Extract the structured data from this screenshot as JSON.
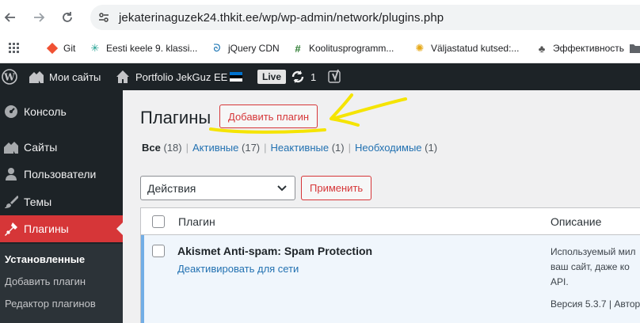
{
  "browser": {
    "url": "jekaterinaguzek24.thkit.ee/wp/wp-admin/network/plugins.php",
    "bookmarks": [
      {
        "label": "Git",
        "icon": "git-icon"
      },
      {
        "label": "Eesti keele 9. klassi...",
        "icon": "puzzle-icon"
      },
      {
        "label": "jQuery CDN",
        "icon": "jquery-icon"
      },
      {
        "label": "Koolitusprogramm...",
        "icon": "hash-icon"
      },
      {
        "label": "Väljastatud kutsed:...",
        "icon": "gear-icon"
      },
      {
        "label": "Эффективность",
        "icon": "drop-icon"
      }
    ]
  },
  "adminbar": {
    "my_sites": "Мои сайты",
    "site_name": "Portfolio JekGuz EE",
    "live_badge": "Live",
    "updates_count": "1"
  },
  "sidebar": {
    "items": [
      {
        "label": "Консоль"
      },
      {
        "label": "Сайты"
      },
      {
        "label": "Пользователи"
      },
      {
        "label": "Темы"
      },
      {
        "label": "Плагины"
      }
    ],
    "submenu": [
      {
        "label": "Установленные"
      },
      {
        "label": "Добавить плагин"
      },
      {
        "label": "Редактор плагинов"
      }
    ]
  },
  "main": {
    "title": "Плагины",
    "add_button": "Добавить плагин",
    "filters": {
      "all": "Все",
      "all_count": "(18)",
      "active": "Активные",
      "active_count": "(17)",
      "inactive": "Неактивные",
      "inactive_count": "(1)",
      "required": "Необходимые",
      "required_count": "(1)"
    },
    "bulk_action": "Действия",
    "apply_button": "Применить",
    "table": {
      "col_plugin": "Плагин",
      "col_description": "Описание",
      "rows": [
        {
          "name": "Akismet Anti-spam: Spam Protection",
          "action": "Деактивировать для сети",
          "desc_line1": "Используемый мил",
          "desc_line2": "ваш сайт, даже ко",
          "desc_line3": "API.",
          "version": "Версия 5.3.7 | Автор"
        }
      ]
    }
  },
  "colors": {
    "accent": "#d63638",
    "annotation": "#f5e400",
    "link": "#2271b1"
  }
}
